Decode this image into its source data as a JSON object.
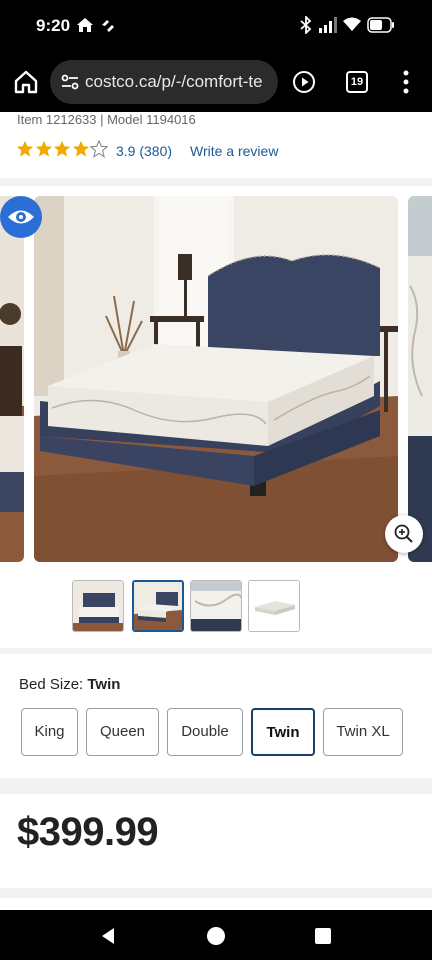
{
  "status": {
    "time": "9:20"
  },
  "browser": {
    "url": "costco.ca/p/-/comfort-te",
    "tab_count": "19"
  },
  "product": {
    "item_model": "Item 1212633 | Model 1194016",
    "rating_value": 3.9,
    "rating_text": "3.9 (380)",
    "review_link": "Write a review",
    "price": "$399.99"
  },
  "gallery": {
    "thumbnail_count": 4,
    "active_thumbnail": 2
  },
  "bed_size": {
    "label": "Bed Size: ",
    "selected_value": "Twin",
    "options": [
      "King",
      "Queen",
      "Double",
      "Twin",
      "Twin XL"
    ]
  },
  "colors": {
    "link": "#1a5a94",
    "eye_button": "#2b6fd6",
    "star": "#f2a900",
    "selected_border": "#1a3f6b"
  }
}
